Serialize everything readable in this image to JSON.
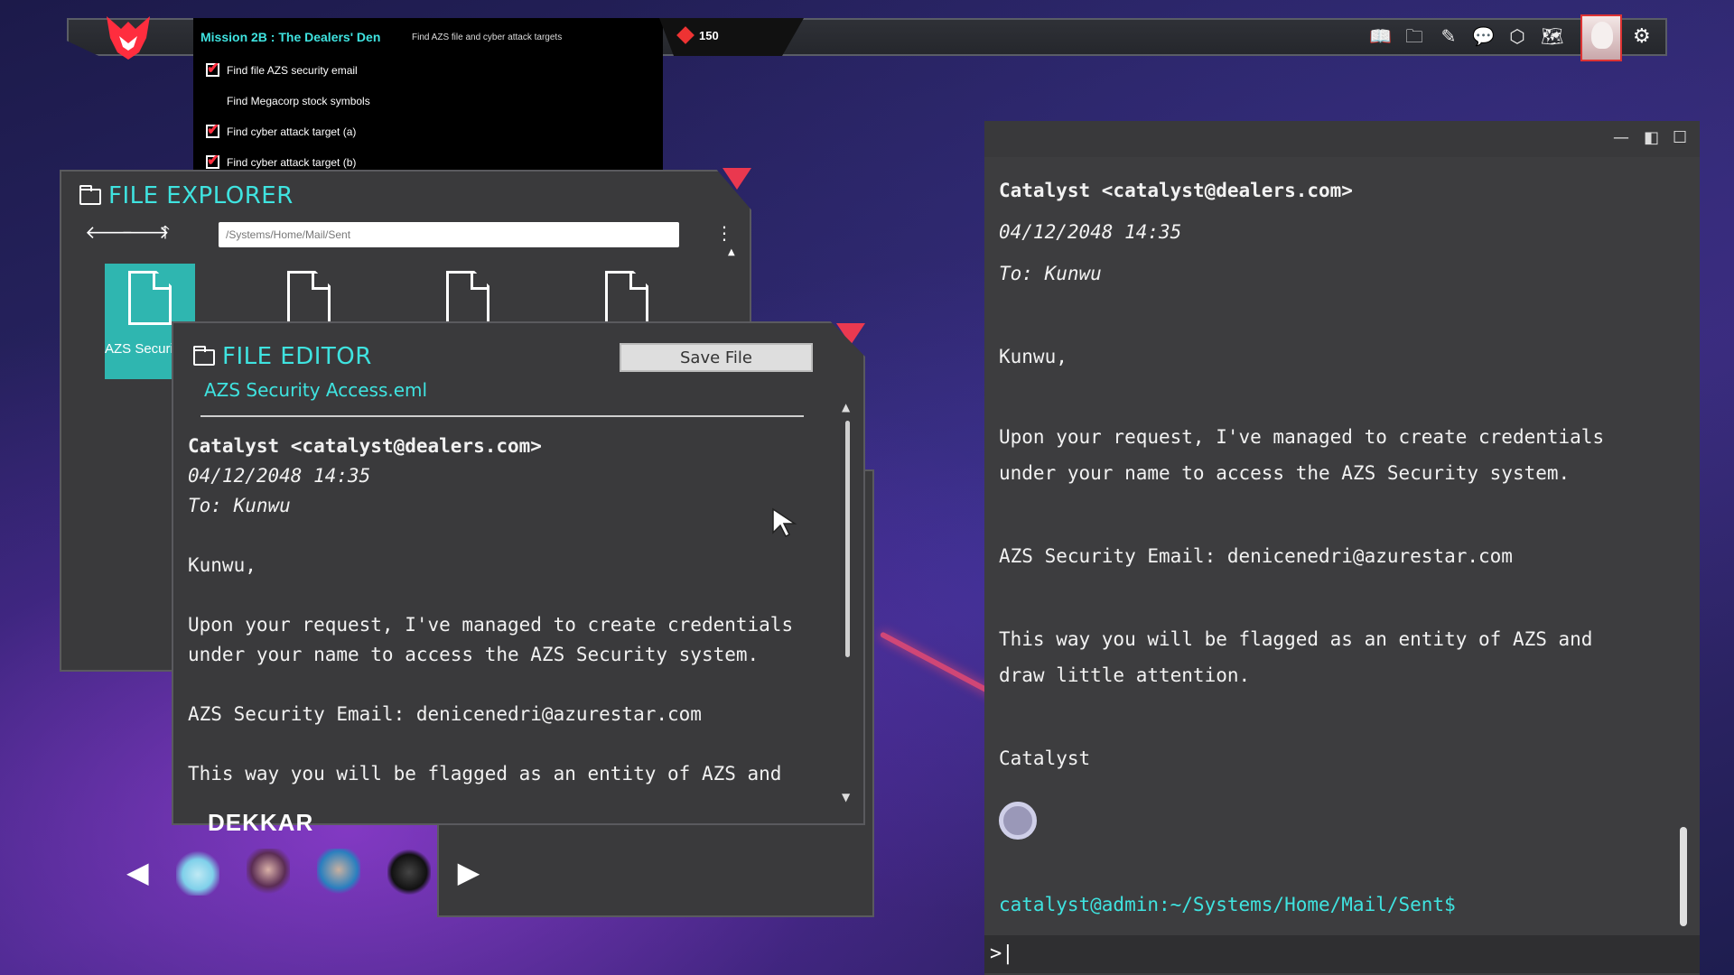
{
  "topbar": {
    "mission_title": "Mission 2B : The Dealers' Den",
    "mission_subtitle": "Find AZS file and cyber attack targets",
    "tasks": [
      {
        "label": "Find file AZS security email",
        "done": true
      },
      {
        "label": "Find Megacorp stock symbols",
        "done": false
      },
      {
        "label": "Find cyber attack target (a)",
        "done": true
      },
      {
        "label": "Find cyber attack target (b)",
        "done": true
      }
    ],
    "credits": "150",
    "icons": [
      "book-icon",
      "folder-icon",
      "edit-icon",
      "chat-icon",
      "hexagon-icon",
      "map-icon"
    ],
    "settings_icon": "gear-icon"
  },
  "explorer": {
    "title": "FILE EXPLORER",
    "path": "/Systems/Home/Mail/Sent",
    "files": [
      {
        "name": "AZS Security Access.eml",
        "selected": true
      },
      {
        "name": "",
        "selected": false
      },
      {
        "name": "",
        "selected": false
      },
      {
        "name": "",
        "selected": false
      }
    ]
  },
  "editor": {
    "title": "FILE EDITOR",
    "save_label": "Save File",
    "filename": "AZS Security Access.eml",
    "lines": {
      "from": "Catalyst <catalyst@dealers.com>",
      "date": "04/12/2048 14:35",
      "to": "To: Kunwu",
      "greeting": "Kunwu,",
      "p1a": "Upon your request, I've managed to create credentials",
      "p1b": "under your name to access the AZS Security system.",
      "email": "AZS Security Email: denicenedri@azurestar.com",
      "p2a": "This way you will be flagged as an entity of AZS and"
    }
  },
  "terminal": {
    "lines": {
      "from": "Catalyst <catalyst@dealers.com>",
      "date": "04/12/2048 14:35",
      "to": "To: Kunwu",
      "greeting": "Kunwu,",
      "p1a": "Upon your request, I've managed to create credentials",
      "p1b": "under your name to access the AZS Security system.",
      "email": "AZS Security Email: denicenedri@azurestar.com",
      "p2a": "This way you will be flagged as an entity of AZS and",
      "p2b": "draw little attention.",
      "sign": "Catalyst"
    },
    "prompt": "catalyst@admin:~/Systems/Home/Mail/Sent$",
    "input": ">|"
  },
  "characters": {
    "label": "DEKKAR"
  },
  "colors": {
    "accent": "#3fe3e0",
    "check": "#ff2d3e",
    "window_bg": "#3a3a3c"
  }
}
